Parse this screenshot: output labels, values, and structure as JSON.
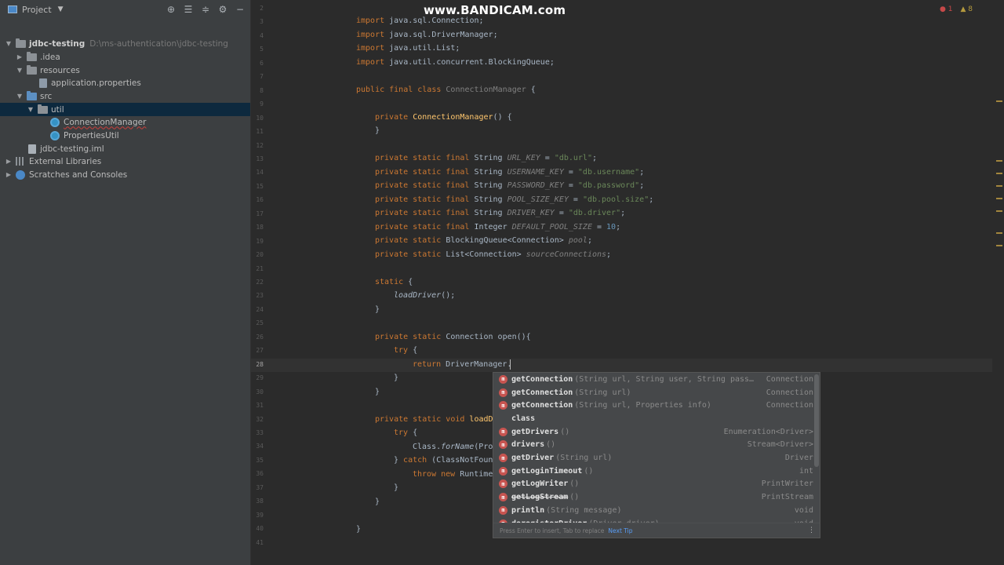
{
  "watermark": "www.BANDICAM.com",
  "project": {
    "title": "Project",
    "header_icons": [
      "target-icon",
      "expand-all-icon",
      "collapse-all-icon",
      "gear-icon",
      "minimize-icon"
    ],
    "tree": [
      {
        "label": "jdbc-testing",
        "path": "D:\\ms-authentication\\jdbc-testing"
      },
      {
        "label": ".idea"
      },
      {
        "label": "resources"
      },
      {
        "label": "application.properties"
      },
      {
        "label": "src"
      },
      {
        "label": "util"
      },
      {
        "label": "ConnectionManager"
      },
      {
        "label": "PropertiesUtil"
      },
      {
        "label": "jdbc-testing.iml"
      },
      {
        "label": "External Libraries"
      },
      {
        "label": "Scratches and Consoles"
      }
    ]
  },
  "inspections": {
    "errors": "1",
    "warnings": "8"
  },
  "editor": {
    "line_numbers": [
      "2",
      "3",
      "4",
      "5",
      "6",
      "7",
      "8",
      "9",
      "10",
      "11",
      "12",
      "13",
      "14",
      "15",
      "16",
      "17",
      "18",
      "19",
      "20",
      "21",
      "22",
      "23",
      "24",
      "25",
      "26",
      "27",
      "28",
      "29",
      "30",
      "31",
      "32",
      "33",
      "34",
      "35",
      "36",
      "37",
      "38",
      "39",
      "40",
      "41"
    ],
    "current_line": "28"
  },
  "completion": {
    "items": [
      {
        "name": "getConnection",
        "sig": "(String url, String user, String pass…",
        "ret": "Connection"
      },
      {
        "name": "getConnection",
        "sig": "(String url)",
        "ret": "Connection"
      },
      {
        "name": "getConnection",
        "sig": "(String url, Properties info)",
        "ret": "Connection"
      },
      {
        "name": "class",
        "sig": "",
        "ret": ""
      },
      {
        "name": "getDrivers",
        "sig": "()",
        "ret": "Enumeration<Driver>"
      },
      {
        "name": "drivers",
        "sig": "()",
        "ret": "Stream<Driver>"
      },
      {
        "name": "getDriver",
        "sig": "(String url)",
        "ret": "Driver"
      },
      {
        "name": "getLoginTimeout",
        "sig": "()",
        "ret": "int"
      },
      {
        "name": "getLogWriter",
        "sig": "()",
        "ret": "PrintWriter"
      },
      {
        "name": "getLogStream",
        "sig": "()",
        "ret": "PrintStream"
      },
      {
        "name": "println",
        "sig": "(String message)",
        "ret": "void"
      },
      {
        "name": "deregisterDriver",
        "sig": "(Driver driver)",
        "ret": "void"
      }
    ],
    "footer_text": "Press Enter to insert, Tab to replace",
    "footer_tip": "Next Tip",
    "more": "⋮"
  }
}
